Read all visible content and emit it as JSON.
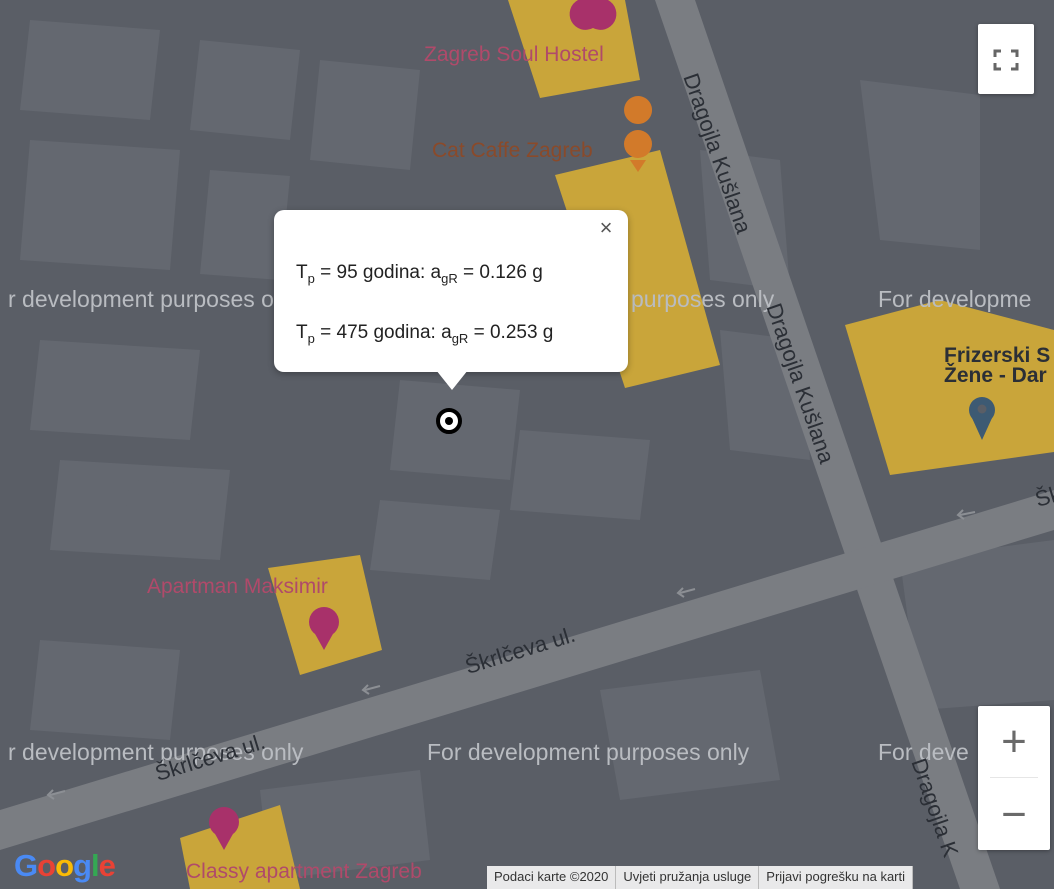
{
  "map": {
    "watermark": "For development purposes only",
    "partial_watermark_left": "r development purposes only",
    "partial_watermark_mid": "purposes only",
    "partial_watermark_right": "For developme",
    "partial_watermark_bottom_left": "r development purposes only",
    "partial_watermark_bottom_right": "For deve",
    "pois": {
      "hostel": "Zagreb Soul Hostel",
      "cafe": "Cat Caffe Zagreb",
      "salon_line1": "Frizerski S",
      "salon_line2": "Žene - Dar",
      "apartment1": "Apartman Maksimir",
      "apartment2": "Classy apartment Zagreb"
    },
    "streets": {
      "dragojla_1": "Dragojla Kušlana",
      "dragojla_2": "Dragojla Kušlana",
      "dragojla_3": "Dragojla K",
      "skrceva_1": "Škrlčeva ul.",
      "skrceva_2": "Škrlčeva ul.",
      "skrceva_right": "Šk"
    }
  },
  "infowindow": {
    "line1": {
      "T": "T",
      "T_sub": "p",
      "years": "= 95 godina:",
      "a": "a",
      "a_sub": "gR",
      "value": "= 0.126 g"
    },
    "line2": {
      "T": "T",
      "T_sub": "p",
      "years": "= 475 godina:",
      "a": "a",
      "a_sub": "gR",
      "value": "= 0.253 g"
    },
    "close": "×"
  },
  "controls": {
    "zoom_in": "+",
    "zoom_out": "−"
  },
  "logo": {
    "G": "G",
    "o1": "o",
    "o2": "o",
    "g": "g",
    "l": "l",
    "e": "e"
  },
  "attribution": {
    "map_data": "Podaci karte ©2020",
    "terms": "Uvjeti pružanja usluge",
    "report": "Prijavi pogrešku na karti"
  },
  "colors": {
    "map_bg": "#5a5e66",
    "block": "#646870",
    "road": "#7a7d82",
    "poi_building": "#c9a53a",
    "pin_red": "#a8316a",
    "pin_orange": "#d27a2a",
    "pin_blue": "#3d5a73"
  }
}
